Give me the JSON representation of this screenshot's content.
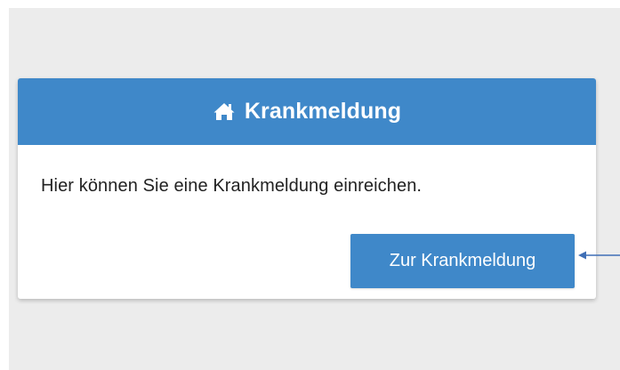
{
  "card": {
    "header_icon": "home-icon",
    "title": "Krankmeldung",
    "body_text": "Hier können Sie eine Krankmeldung einreichen.",
    "button_label": "Zur Krankmeldung"
  },
  "colors": {
    "page_background": "#ececec",
    "header_background": "#3f88c9",
    "button_background": "#3f88c9",
    "annotation_arrow": "#3f6fb6"
  },
  "annotation": {
    "icon": "arrow-left-icon"
  }
}
